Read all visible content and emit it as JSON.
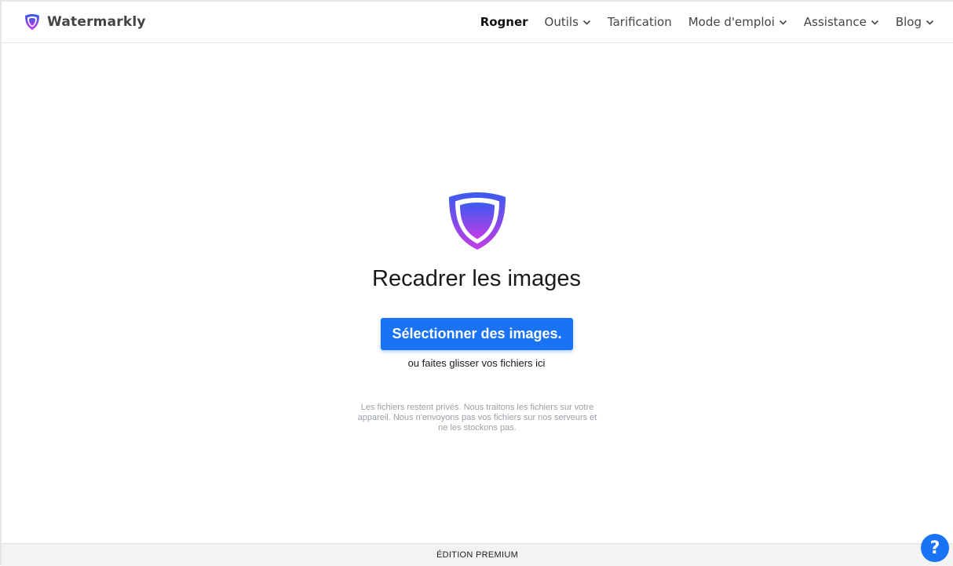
{
  "brand": {
    "name": "Watermarkly",
    "logo_icon": "shield-icon"
  },
  "nav": {
    "items": [
      {
        "label": "Rogner",
        "active": true,
        "dropdown": false
      },
      {
        "label": "Outils",
        "active": false,
        "dropdown": true
      },
      {
        "label": "Tarification",
        "active": false,
        "dropdown": false
      },
      {
        "label": "Mode d'emploi",
        "active": false,
        "dropdown": true
      },
      {
        "label": "Assistance",
        "active": false,
        "dropdown": true
      },
      {
        "label": "Blog",
        "active": false,
        "dropdown": true
      }
    ]
  },
  "main": {
    "title": "Recadrer les images",
    "select_button": "Sélectionner des images.",
    "drag_hint": "ou faites glisser vos fichiers ici",
    "privacy_note": "Les fichiers restent privés. Nous traitons les fichiers sur votre appareil. Nous n'envoyons pas vos fichiers sur nos serveurs et ne les stockons pas."
  },
  "footer": {
    "label": "ÉDITION PREMIUM"
  },
  "help": {
    "label": "?",
    "icon": "help-icon"
  },
  "colors": {
    "accent": "#1a73f5",
    "shield_top": "#3b5bf0",
    "shield_bottom": "#c23be6"
  }
}
